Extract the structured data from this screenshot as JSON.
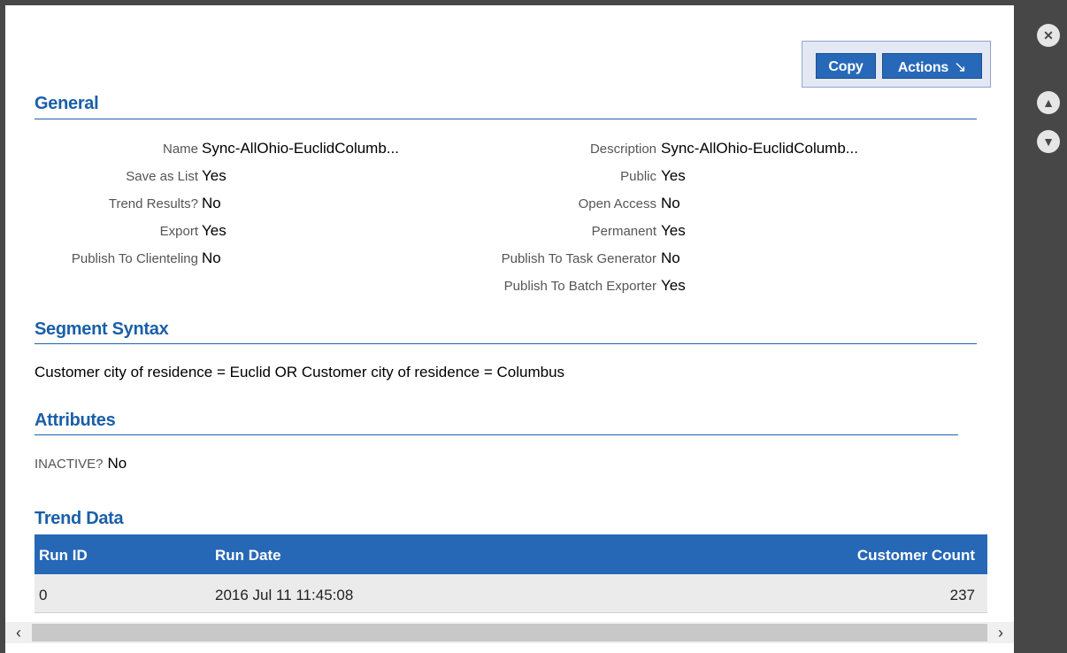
{
  "toolbar": {
    "copy_label": "Copy",
    "actions_label": "Actions",
    "actions_arrow": "↘"
  },
  "general": {
    "title": "General",
    "left": [
      {
        "label": "Name",
        "value": "Sync-AllOhio-EuclidColumb..."
      },
      {
        "label": "Save as List",
        "value": "Yes"
      },
      {
        "label": "Trend Results?",
        "value": "No"
      },
      {
        "label": "Export",
        "value": "Yes"
      },
      {
        "label": "Publish To Clienteling",
        "value": "No"
      }
    ],
    "right": [
      {
        "label": "Description",
        "value": "Sync-AllOhio-EuclidColumb..."
      },
      {
        "label": "Public",
        "value": "Yes"
      },
      {
        "label": "Open Access",
        "value": "No"
      },
      {
        "label": "Permanent",
        "value": "Yes"
      },
      {
        "label": "Publish To Task Generator",
        "value": "No"
      },
      {
        "label": "Publish To Batch Exporter",
        "value": "Yes"
      }
    ]
  },
  "segment": {
    "title": "Segment Syntax",
    "text": "Customer city of residence = Euclid OR Customer city of residence = Columbus"
  },
  "attributes": {
    "title": "Attributes",
    "label": "INACTIVE?",
    "value": "No"
  },
  "trend": {
    "title": "Trend Data",
    "headers": [
      "Run ID",
      "Run Date",
      "Customer Count"
    ],
    "rows": [
      [
        "0",
        "2016 Jul 11 11:45:08",
        "237"
      ]
    ]
  },
  "side_controls": {
    "close_icon": "close-icon",
    "up_icon": "up-icon",
    "down_icon": "down-icon"
  },
  "colors": {
    "accent": "#1a5fa8",
    "header_bg": "#2668b6",
    "chrome": "#474747"
  }
}
